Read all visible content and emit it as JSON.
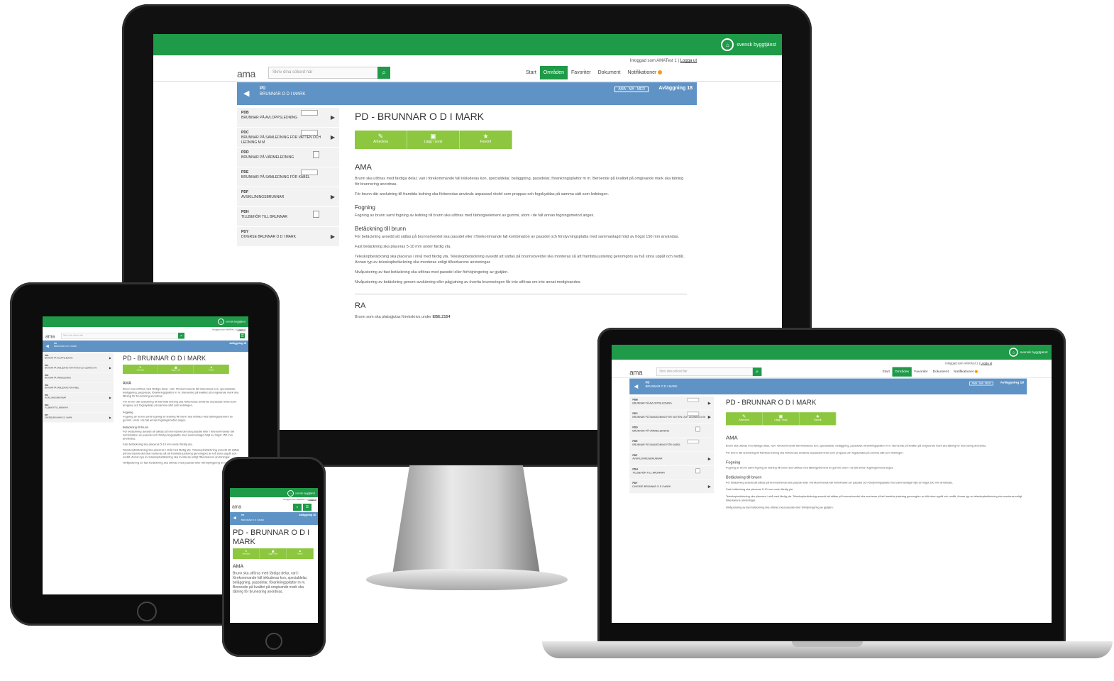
{
  "site": {
    "brand": "svensk byggtjänst",
    "login_text": "Inloggad som AMATest 1",
    "logout_label": "Logga ut",
    "logo": "ama",
    "search_placeholder": "Skriv dina sökord här",
    "nav": [
      "Start",
      "Områden",
      "Favoriter",
      "Dokument",
      "Notifikationer"
    ],
    "nav_active": "Områden",
    "breadcrumb": {
      "code": "PD",
      "name": "BRUNNAR O D I MARK",
      "tag": "AMA · MA · MER",
      "version": "Avläggning 18"
    },
    "sidebar": [
      {
        "code": "PDB",
        "name": "BRUNNAR PÅ AVLOPPSLEDNING"
      },
      {
        "code": "PDC",
        "name": "BRUNNAR PÅ SAMLEDNING FÖR VATTEN OCH LEDNING M M"
      },
      {
        "code": "PDD",
        "name": "BRUNNAR PÅ VÄRMELEDNING"
      },
      {
        "code": "PDE",
        "name": "BRUNNAR PÅ SAMLEDNING FÖR KABEL"
      },
      {
        "code": "PDF",
        "name": "AVSKILJNINGSBRUNNAR"
      },
      {
        "code": "PDH",
        "name": "TILLBEHÖR TILL BRUNNAR"
      },
      {
        "code": "PDY",
        "name": "DIVERSE BRUNNAR O D I MARK"
      }
    ],
    "page_title": "PD - BRUNNAR O D I MARK",
    "phone_title_line1": "PD - BRUNNAR O D I",
    "phone_title_line2": "MARK",
    "actions": [
      {
        "icon": "✎",
        "label": "Anteckna"
      },
      {
        "icon": "▣",
        "label": "Lägg i urval"
      },
      {
        "icon": "★",
        "label": "Favorit"
      }
    ],
    "section_ama": "AMA",
    "p1": "Brunn ska utföras med färdiga delar, vari i förekommande fall inkluderas kon, specialdelar, beläggning, passdelar, förankringsplattor m m. Beroende på kvalitet på omgivande mark ska tätning för brunnsring anordnas.",
    "p2": "För brunn där anslutning till framtida ledning ska förberedas används anpassad rördel som proppas och fogskyddas på samma sätt som ledningen.",
    "section_fog": "Fogning",
    "p3": "Fogning av brunn samt fogning av ledning till brunn ska utföras med tätningselement av gummi, utom i de fall annan fogningsmetod anges.",
    "section_bet": "Betäckning till brunn",
    "p4": "För betäckning avsedd att sättas på brunnsöverdel ska passdel eller i förekommande fall kombination av passdel och förstyvningsplatta med sammanlagd höjd av högst 150 mm användas.",
    "p5": "Fast betäckning ska placeras 5-10 mm under färdig yta.",
    "p6": "Teleskopbetäckning ska placeras i nivå med färdig yta. Teleskopbetäckning avsedd att sättas på brunnsöverdel ska monteras så att framtida justering genomgörs av två stora uppåt och nedåt. Annan typ av teleskopbetäckning ska monteras enligt tillverkarens anvisningar.",
    "p7": "Nivåjustering av fast betäckning ska utföras med passdel eller förhöjningsring av gjutjärn.",
    "p8": "Nivåjustering av betäckning genom avskärning eller pågjutning av övertia brunnsringen får inte utföras om inte annat medgivandes.",
    "section_ra": "RA",
    "p9": "Brunn som ska platsgjutas förekskrivs under",
    "p9_ref": "EBE.2154",
    "hamburger": "☰",
    "search_icon": "⌕"
  },
  "colors": {
    "green": "#1e9a48",
    "lightgreen": "#8cc73f",
    "blue": "#5f93c5"
  }
}
